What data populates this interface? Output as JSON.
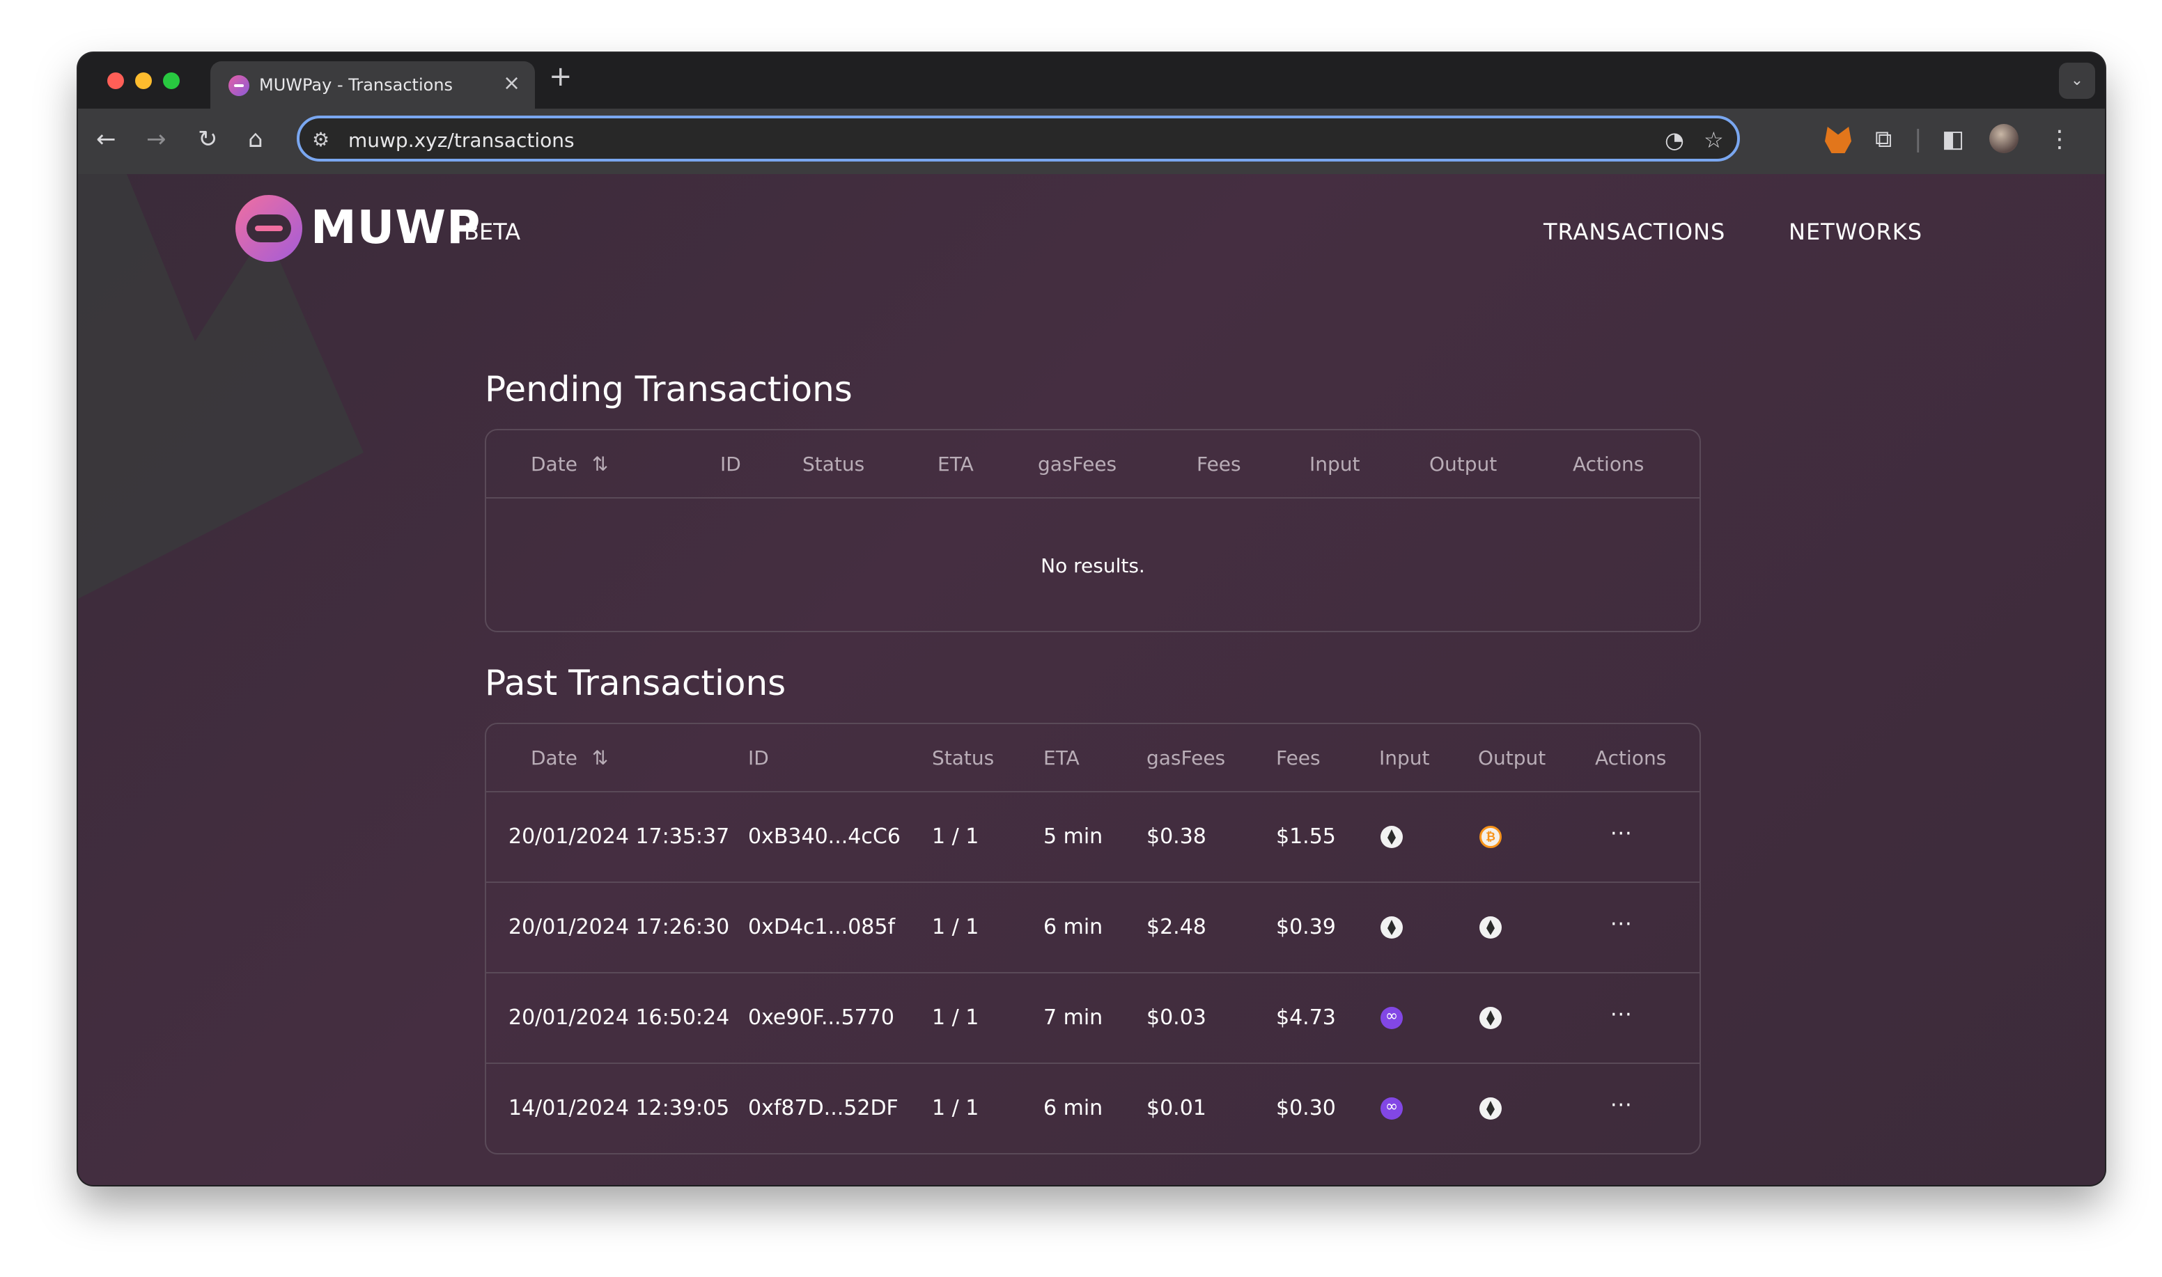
{
  "browser": {
    "tab_title": "MUWPay - Transactions",
    "tab_close": "×",
    "new_tab": "+",
    "url": "muwp.xyz/transactions"
  },
  "site": {
    "logo_text": "MUWP",
    "logo_badge": "BETA",
    "nav": [
      "TRANSACTIONS",
      "NETWORKS"
    ]
  },
  "pending": {
    "title": "Pending Transactions",
    "columns": [
      "Date",
      "ID",
      "Status",
      "ETA",
      "gasFees",
      "Fees",
      "Input",
      "Output",
      "Actions"
    ],
    "sort_glyph": "⇅",
    "empty_text": "No results."
  },
  "past": {
    "title": "Past Transactions",
    "columns": [
      "Date",
      "ID",
      "Status",
      "ETA",
      "gasFees",
      "Fees",
      "Input",
      "Output",
      "Actions"
    ],
    "sort_glyph": "⇅",
    "rows": [
      {
        "date": "20/01/2024 17:35:37",
        "id": "0xB340...4cC6",
        "status": "1 / 1",
        "eta": "5 min",
        "gas": "$0.38",
        "fees": "$1.55",
        "input": "ethereum-icon",
        "output": "bitcoin-icon",
        "action": "···"
      },
      {
        "date": "20/01/2024 17:26:30",
        "id": "0xD4c1...085f",
        "status": "1 / 1",
        "eta": "6 min",
        "gas": "$2.48",
        "fees": "$0.39",
        "input": "ethereum-icon",
        "output": "ethereum-icon",
        "action": "···"
      },
      {
        "date": "20/01/2024 16:50:24",
        "id": "0xe90F...5770",
        "status": "1 / 1",
        "eta": "7 min",
        "gas": "$0.03",
        "fees": "$4.73",
        "input": "polygon-icon",
        "output": "ethereum-icon",
        "action": "···"
      },
      {
        "date": "14/01/2024 12:39:05",
        "id": "0xf87D...52DF",
        "status": "1 / 1",
        "eta": "6 min",
        "gas": "$0.01",
        "fees": "$0.30",
        "input": "polygon-icon",
        "output": "ethereum-icon",
        "action": "···"
      }
    ]
  },
  "colors": {
    "page_bg": "#3b2b3a",
    "accent_pink": "#f06fa0",
    "accent_purple": "#a35cd8",
    "table_border": "#5a4a58",
    "omnibox_focus": "#7aa7f0"
  }
}
